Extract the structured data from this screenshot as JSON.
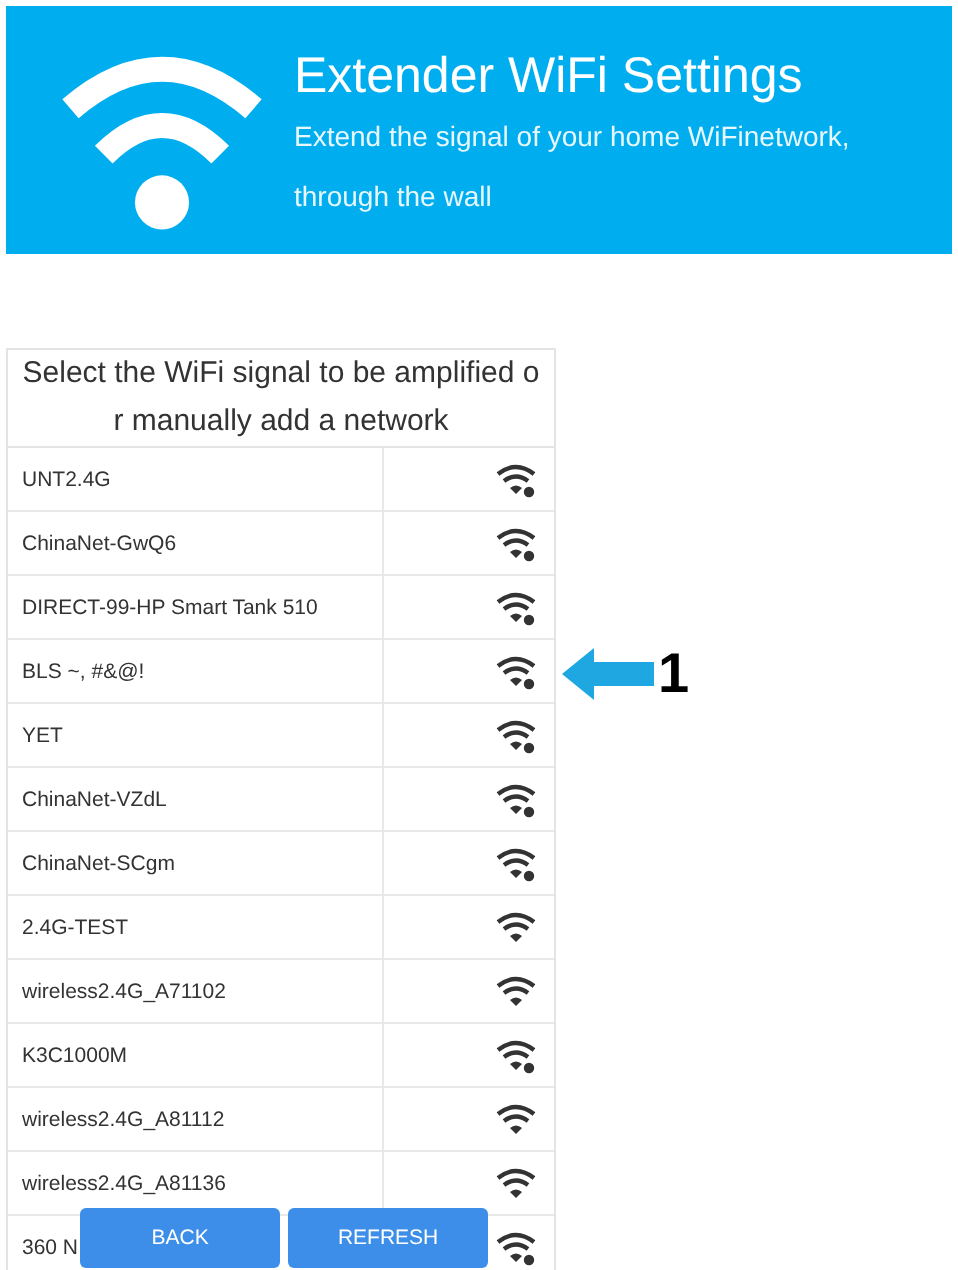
{
  "header": {
    "title": "Extender WiFi Settings",
    "subtitle_lines": [
      "Extend the signal of your home WiFinetwork,",
      "through the wall"
    ]
  },
  "list": {
    "heading": "Select the WiFi signal to be amplified o r manually add a network",
    "networks": [
      {
        "name": "UNT2.4G",
        "locked": true,
        "pointed_at": false
      },
      {
        "name": "ChinaNet-GwQ6",
        "locked": true,
        "pointed_at": false
      },
      {
        "name": "DIRECT-99-HP Smart Tank 510",
        "locked": true,
        "pointed_at": false
      },
      {
        "name": "BLS ~, #&@!",
        "locked": true,
        "pointed_at": true
      },
      {
        "name": "YET",
        "locked": true,
        "pointed_at": false
      },
      {
        "name": "ChinaNet-VZdL",
        "locked": true,
        "pointed_at": false
      },
      {
        "name": "ChinaNet-SCgm",
        "locked": true,
        "pointed_at": false
      },
      {
        "name": "2.4G-TEST",
        "locked": false,
        "pointed_at": false
      },
      {
        "name": "wireless2.4G_A71102",
        "locked": false,
        "pointed_at": false
      },
      {
        "name": "K3C1000M",
        "locked": true,
        "pointed_at": false
      },
      {
        "name": "wireless2.4G_A81112",
        "locked": false,
        "pointed_at": false
      },
      {
        "name": "wireless2.4G_A81136",
        "locked": false,
        "pointed_at": false
      },
      {
        "name": "360 N",
        "locked": true,
        "pointed_at": false
      }
    ]
  },
  "callout": {
    "label": "1"
  },
  "buttons": [
    "BACK",
    "REFRESH"
  ]
}
